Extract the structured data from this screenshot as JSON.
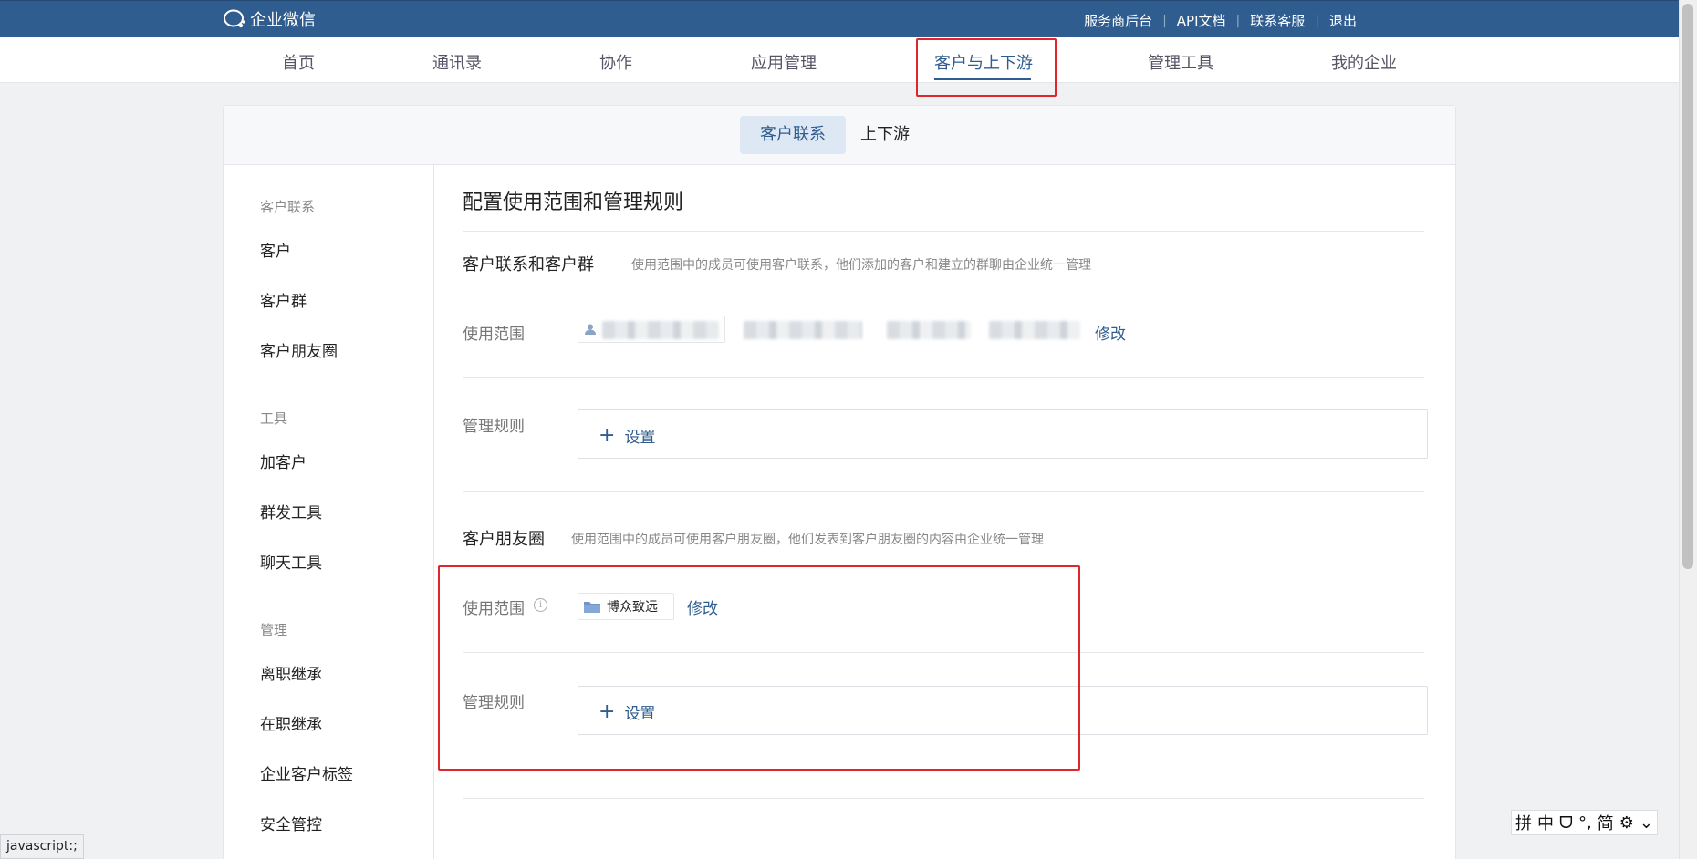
{
  "topbar": {
    "logo_text": "企业微信",
    "links": [
      "服务商后台",
      "API文档",
      "联系客服",
      "退出"
    ],
    "color": "#2f5d8f"
  },
  "mainnav": {
    "items": [
      "首页",
      "通讯录",
      "协作",
      "应用管理",
      "客户与上下游",
      "管理工具",
      "我的企业"
    ],
    "active_index": 4
  },
  "subtabs": [
    "客户联系",
    "上下游"
  ],
  "sidebar": {
    "groups": [
      {
        "title": "客户联系",
        "items": [
          "客户",
          "客户群",
          "客户朋友圈"
        ]
      },
      {
        "title": "工具",
        "items": [
          "加客户",
          "群发工具",
          "聊天工具"
        ]
      },
      {
        "title": "管理",
        "items": [
          "离职继承",
          "在职继承",
          "企业客户标签",
          "安全管控"
        ]
      }
    ]
  },
  "content": {
    "page_title": "配置使用范围和管理规则",
    "section1": {
      "title": "客户联系和客户群",
      "desc": "使用范围中的成员可使用客户联系，他们添加的客户和建立的群聊由企业统一管理",
      "scope_label": "使用范围",
      "modify": "修改",
      "rules_label": "管理规则",
      "set_label": "设置"
    },
    "section2": {
      "title": "客户朋友圈",
      "desc": "使用范围中的成员可使用客户朋友圈，他们发表到客户朋友圈的内容由企业统一管理",
      "scope_label": "使用范围",
      "scope_chip": "博众致远",
      "modify": "修改",
      "rules_label": "管理规则",
      "set_label": "设置"
    }
  },
  "status_bar": "javascript:;",
  "ime": [
    "拼",
    "中",
    "ᗜ",
    "°,",
    "简",
    "⚙",
    "⌄"
  ],
  "accent_red": "#e0262a"
}
